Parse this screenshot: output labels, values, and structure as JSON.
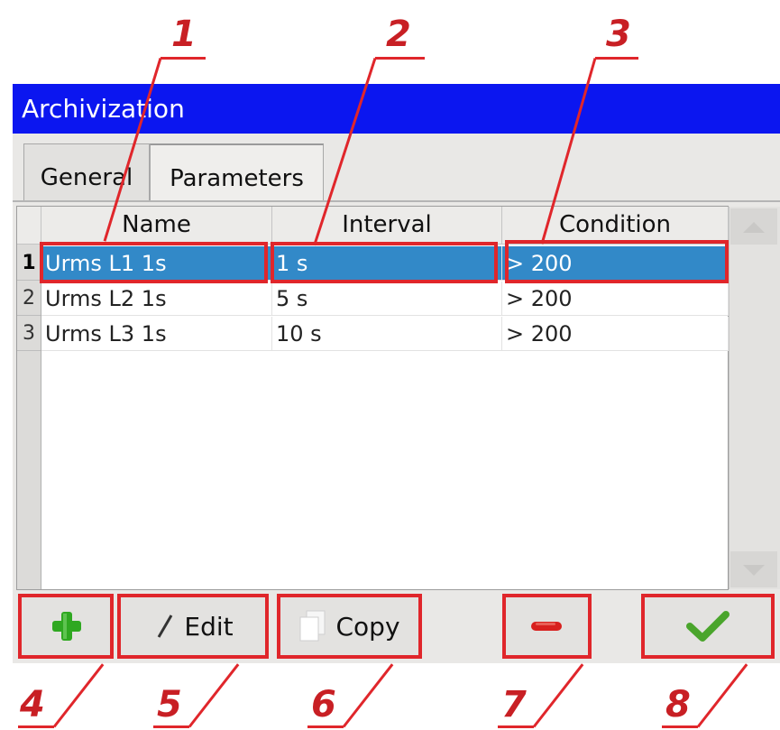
{
  "window": {
    "title": "Archivization"
  },
  "tabs": [
    {
      "label": "General",
      "active": false
    },
    {
      "label": "Parameters",
      "active": true
    }
  ],
  "table": {
    "columns": [
      "Name",
      "Interval",
      "Condition"
    ],
    "rows": [
      {
        "num": "1",
        "name": "Urms L1 1s",
        "interval": "1 s",
        "condition": "> 200",
        "selected": true
      },
      {
        "num": "2",
        "name": "Urms L2 1s",
        "interval": "5 s",
        "condition": "> 200",
        "selected": false
      },
      {
        "num": "3",
        "name": "Urms L3 1s",
        "interval": "10 s",
        "condition": "> 200",
        "selected": false
      }
    ]
  },
  "buttons": {
    "add_icon": "plus-icon",
    "edit_label": "Edit",
    "copy_label": "Copy",
    "remove_icon": "minus-icon",
    "ok_icon": "checkmark-icon"
  },
  "callouts": [
    "1",
    "2",
    "3",
    "4",
    "5",
    "6",
    "7",
    "8"
  ],
  "colors": {
    "titlebar": "#0b16f0",
    "selection": "#3289c8",
    "callout": "#e0262b",
    "add": "#2fa821",
    "remove": "#d8201e",
    "ok": "#4aa52c"
  }
}
